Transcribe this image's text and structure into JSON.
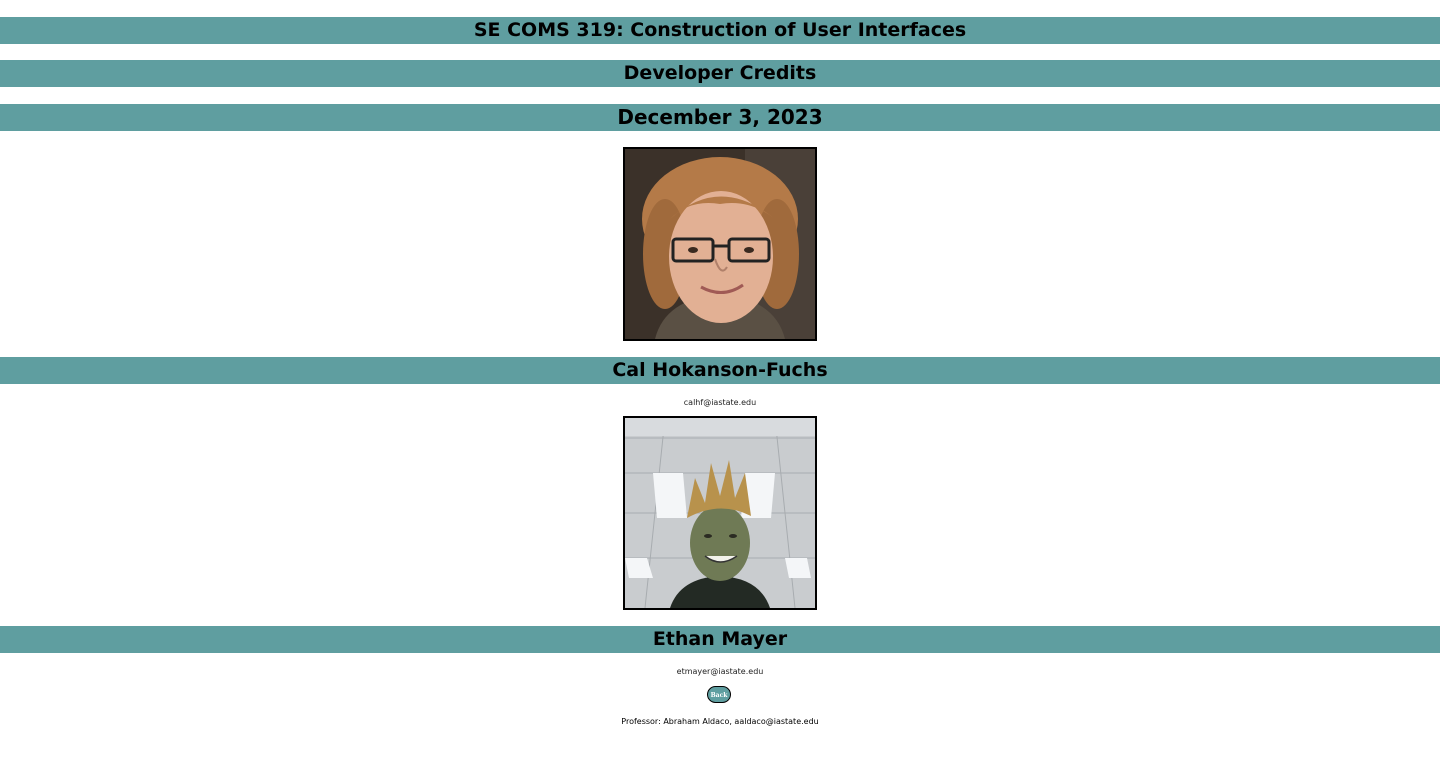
{
  "header": {
    "course_title": "SE COMS 319: Construction of User Interfaces",
    "page_title": "Developer Credits",
    "date": "December 3, 2023"
  },
  "developers": [
    {
      "name": "Cal Hokanson-Fuchs",
      "email": "calhf@iastate.edu"
    },
    {
      "name": "Ethan Mayer",
      "email": "etmayer@iastate.edu"
    }
  ],
  "actions": {
    "back_label": "Back"
  },
  "footer": {
    "professor": "Professor: Abraham Aldaco, aaldaco@iastate.edu"
  },
  "colors": {
    "band": "#5f9ea0",
    "background": "#ffffff"
  }
}
